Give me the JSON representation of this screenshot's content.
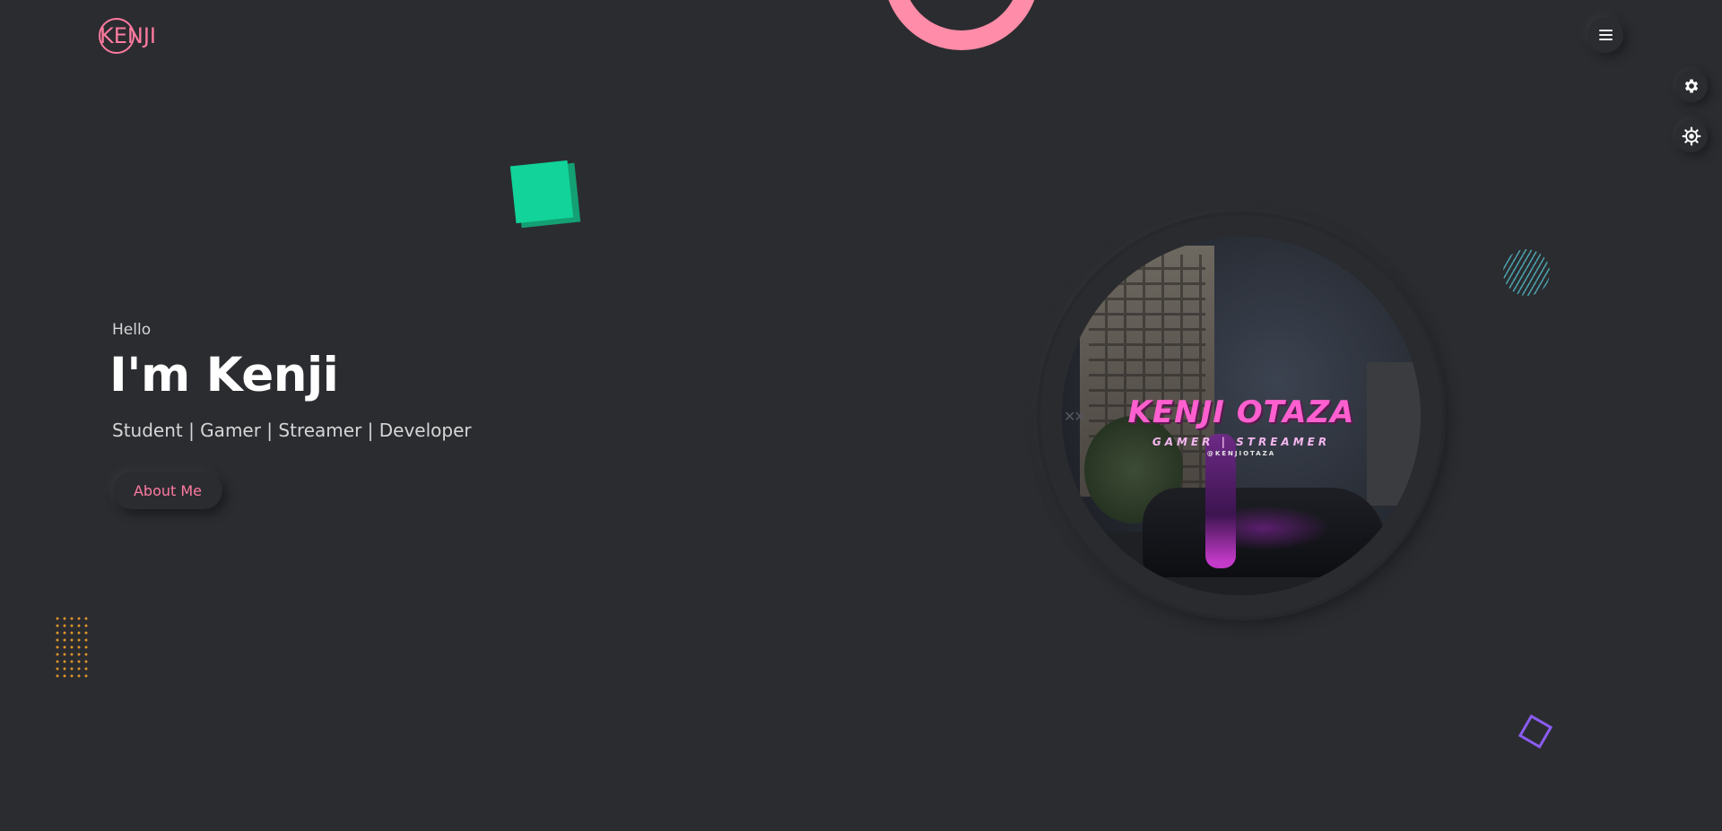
{
  "header": {
    "logo_text": "KENJI",
    "menu_icon": "hamburger-icon"
  },
  "side_tools": [
    {
      "icon": "gear-icon"
    },
    {
      "icon": "sun-gear-icon"
    }
  ],
  "hero": {
    "greeting": "Hello",
    "title": "I'm Kenji",
    "subtitle": "Student | Gamer | Streamer | Developer",
    "cta_label": "About Me"
  },
  "profile_image": {
    "name": "KENJI OTAZA",
    "tagline": "GAMER | STREAMER",
    "handle": "@KENJIOTAZA"
  },
  "colors": {
    "background": "#2b2c30",
    "accent_pink": "#ff7aa0",
    "deco_green": "#12d39a",
    "deco_purple": "#8a5cf0",
    "deco_teal": "#4aa3ad",
    "deco_orange": "#e0962a"
  }
}
